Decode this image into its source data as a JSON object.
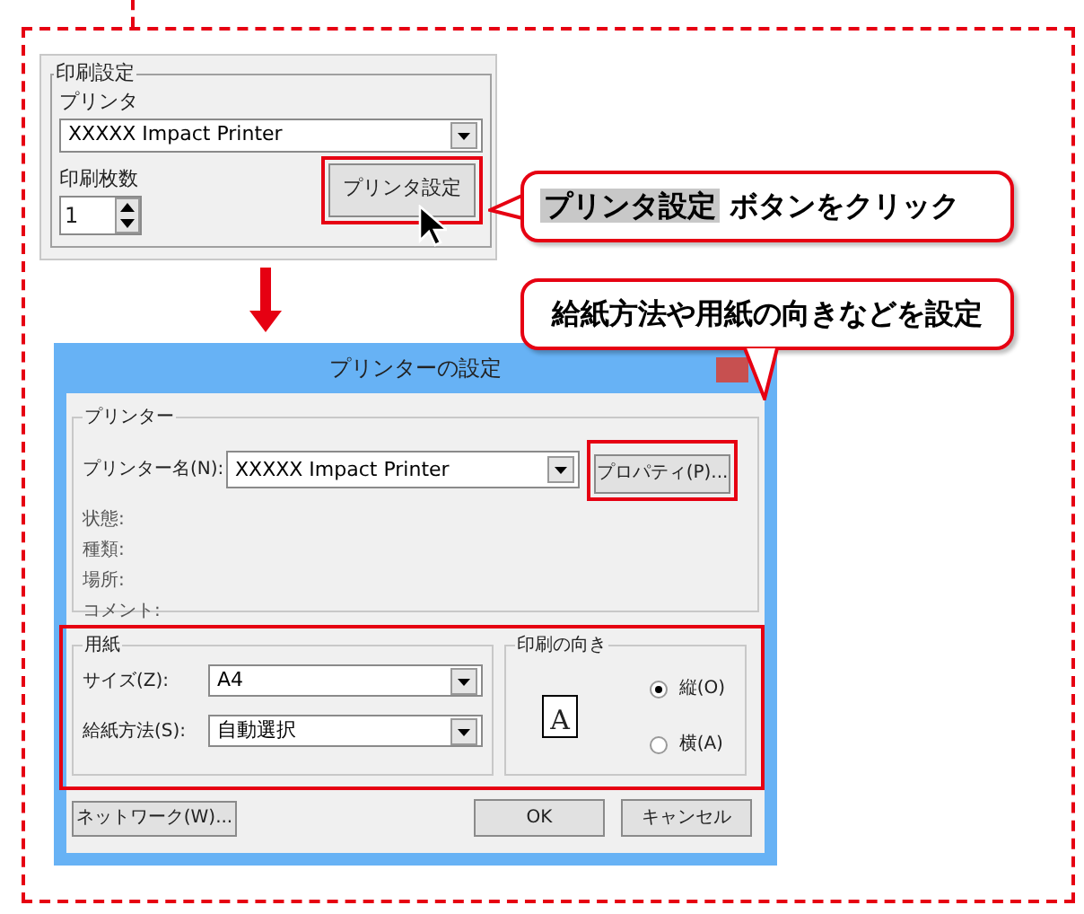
{
  "print_settings": {
    "title": "印刷設定",
    "printer_label": "プリンタ",
    "printer_value": "XXXXX Impact Printer",
    "copies_label": "印刷枚数",
    "copies_value": "1",
    "button": "プリンタ設定"
  },
  "callouts": [
    {
      "highlight": "プリンタ設定",
      "text": "ボタンをクリック"
    },
    {
      "text": "給紙方法や用紙の向きなどを設定"
    }
  ],
  "dialog": {
    "title": "プリンターの設定",
    "printer_group": "プリンター",
    "name_label": "プリンター名(N):",
    "name_value": "XXXXX Impact Printer",
    "properties_button": "プロパティ(P)...",
    "info_labels": [
      "状態:",
      "種類:",
      "場所:",
      "コメント:"
    ],
    "paper_group": "用紙",
    "size_label": "サイズ(Z):",
    "size_value": "A4",
    "source_label": "給紙方法(S):",
    "source_value": "自動選択",
    "orientation_group": "印刷の向き",
    "page_icon_letter": "A",
    "orientation_options": [
      {
        "label": "縦(O)",
        "selected": true
      },
      {
        "label": "横(A)",
        "selected": false
      }
    ],
    "network_button": "ネットワーク(W)...",
    "ok_button": "OK",
    "cancel_button": "キャンセル"
  }
}
